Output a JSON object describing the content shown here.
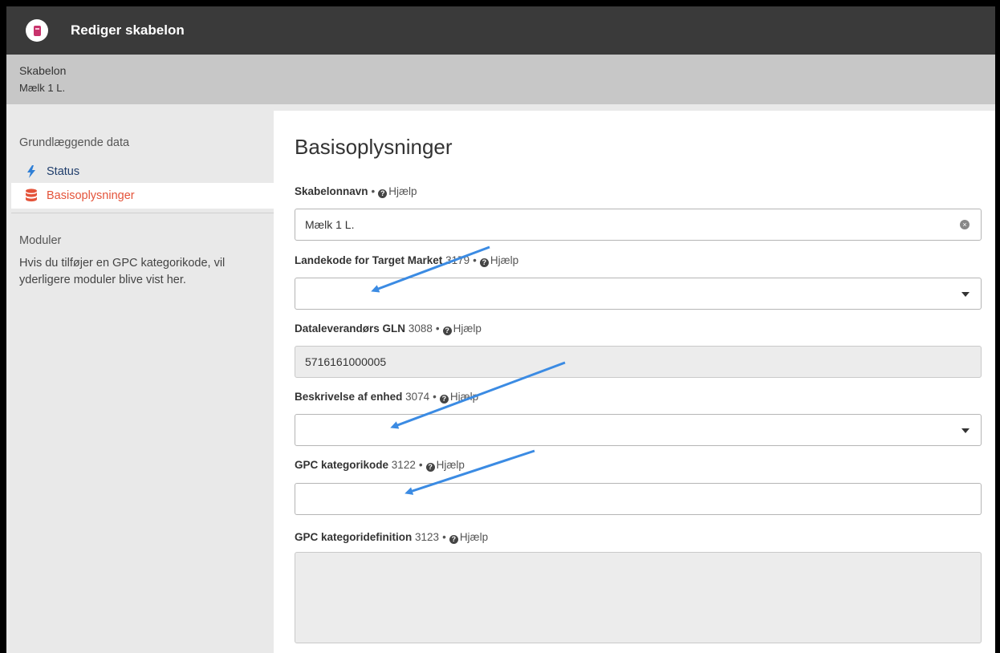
{
  "header": {
    "title": "Rediger skabelon",
    "icon": "template-icon"
  },
  "subheader": {
    "label": "Skabelon",
    "value": "Mælk 1 L."
  },
  "sidebar": {
    "section1_title": "Grundlæggende data",
    "items": [
      {
        "label": "Status",
        "icon": "lightning-icon",
        "color": "#1f3d6b"
      },
      {
        "label": "Basisoplysninger",
        "icon": "database-icon",
        "color": "#e4533a",
        "active": true
      }
    ],
    "section2_title": "Moduler",
    "modules_text": "Hvis du tilføjer en GPC kategorikode, vil yderligere moduler blive vist her."
  },
  "main": {
    "heading": "Basisoplysninger",
    "help_label": "Hjælp",
    "fields": [
      {
        "label": "Skabelonnavn",
        "code": "",
        "value": "Mælk 1 L.",
        "type": "text"
      },
      {
        "label": "Landekode for Target Market",
        "code": "3179",
        "value": "",
        "type": "select"
      },
      {
        "label": "Dataleverandørs GLN",
        "code": "3088",
        "value": "5716161000005",
        "type": "readonly"
      },
      {
        "label": "Beskrivelse af enhed",
        "code": "3074",
        "value": "",
        "type": "select"
      },
      {
        "label": "GPC kategorikode",
        "code": "3122",
        "value": "",
        "type": "text"
      },
      {
        "label": "GPC kategoridefinition",
        "code": "3123",
        "value": "",
        "type": "textarea-readonly"
      }
    ]
  },
  "colors": {
    "accent_arrow": "#3b8be3",
    "titlebar": "#3a3a3a",
    "active_nav": "#e4533a"
  }
}
